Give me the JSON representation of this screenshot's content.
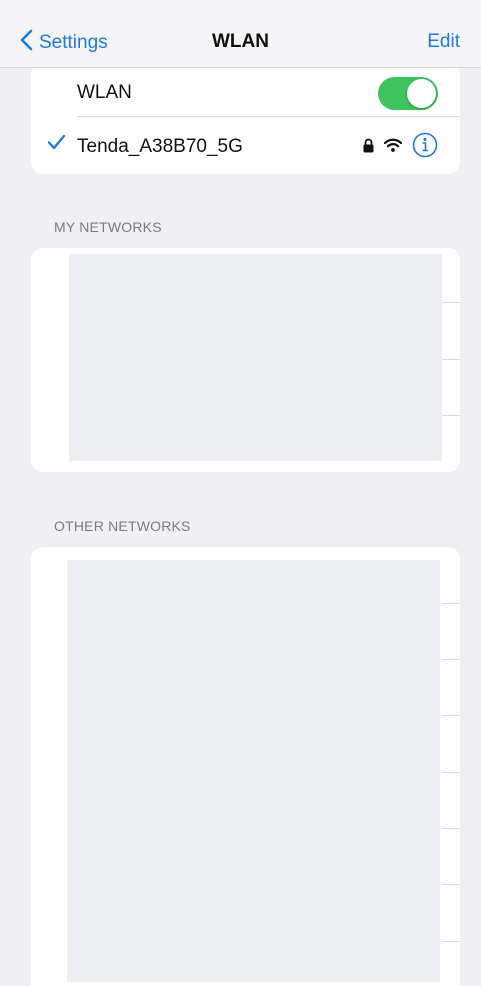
{
  "navbar": {
    "back_label": "Settings",
    "title": "WLAN",
    "edit_label": "Edit"
  },
  "wlan": {
    "label": "WLAN",
    "enabled": true,
    "connected_network": "Tenda_A38B70_5G"
  },
  "my_networks": {
    "header": "MY NETWORKS"
  },
  "other_networks": {
    "header": "OTHER NETWORKS"
  },
  "colors": {
    "accent": "#1f7ad8",
    "toggle_on": "#3fc35e",
    "background": "#f0f0f4"
  },
  "icons": [
    "chevron-left-icon",
    "checkmark-icon",
    "lock-icon",
    "wifi-icon",
    "info-icon"
  ]
}
